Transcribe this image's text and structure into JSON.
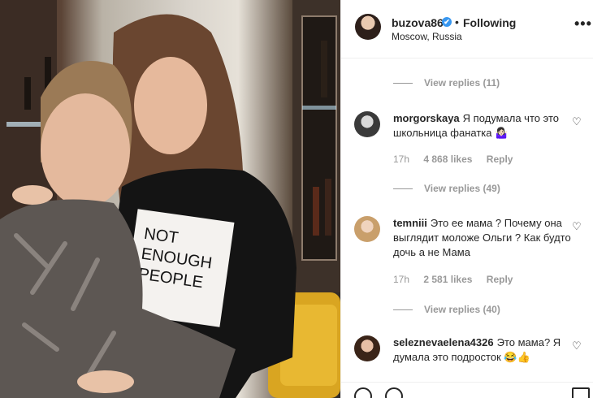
{
  "header": {
    "username": "buzova86",
    "verified_icon": "✔",
    "separator": "•",
    "follow_status": "Following",
    "location": "Moscow, Russia",
    "more_icon": "•••"
  },
  "thread": [
    {
      "type": "replies",
      "label": "View replies (11)"
    },
    {
      "type": "comment",
      "username": "morgorskaya",
      "text": "Я подумала что это школьница фанатка 🤷🏻‍♀️",
      "time": "17h",
      "likes": "4 868 likes",
      "reply": "Reply"
    },
    {
      "type": "replies",
      "label": "View replies (49)"
    },
    {
      "type": "comment",
      "username": "temniii",
      "text": "Это ее мама ? Почему она выглядит моложе Ольги ? Как будто дочь а не Мама",
      "time": "17h",
      "likes": "2 581 likes",
      "reply": "Reply"
    },
    {
      "type": "replies",
      "label": "View replies (40)"
    },
    {
      "type": "comment",
      "username": "seleznevaelena4326",
      "text": "Это мама? Я думала это подросток 😂👍"
    }
  ],
  "photo": {
    "shirt_text": "NOT ENOUGH PEOPLE"
  },
  "icons": {
    "heart": "♡"
  }
}
